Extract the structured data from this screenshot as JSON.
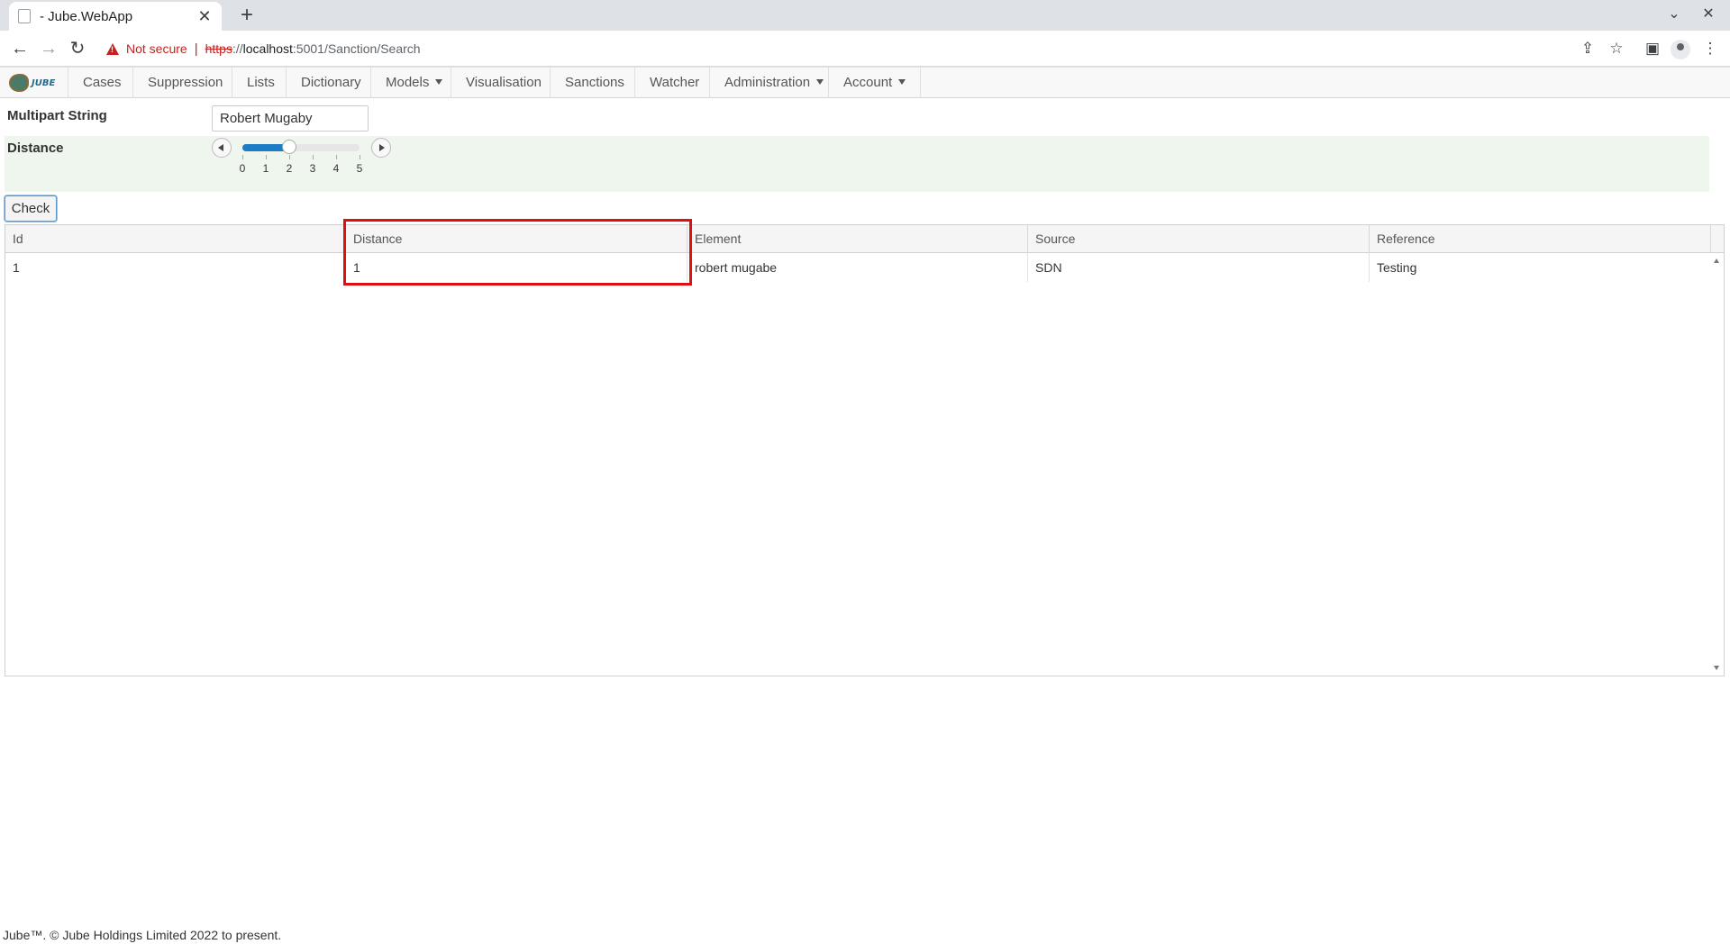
{
  "browser": {
    "tab_title": "- Jube.WebApp",
    "close_tab": "✕",
    "new_tab": "+",
    "not_secure": "Not secure",
    "separator": "|",
    "url_scheme": "https",
    "url_scheme_sep": "://",
    "url_host": "localhost",
    "url_rest": ":5001/Sanction/Search"
  },
  "app": {
    "logo_text": "JUBE",
    "nav": [
      "Cases",
      "Suppression",
      "Lists",
      "Dictionary",
      "Models",
      "Visualisation",
      "Sanctions",
      "Watcher",
      "Administration",
      "Account"
    ]
  },
  "form": {
    "multipart_label": "Multipart String",
    "multipart_value": "Robert Mugaby",
    "distance_label": "Distance",
    "distance_value": 2,
    "distance_ticks": [
      "0",
      "1",
      "2",
      "3",
      "4",
      "5"
    ],
    "check_button": "Check"
  },
  "grid": {
    "columns": [
      "Id",
      "Distance",
      "Element",
      "Source",
      "Reference"
    ],
    "rows": [
      [
        "1",
        "1",
        "robert mugabe",
        "SDN",
        "Testing"
      ]
    ]
  },
  "footer": "Jube™. © Jube Holdings Limited 2022 to present."
}
